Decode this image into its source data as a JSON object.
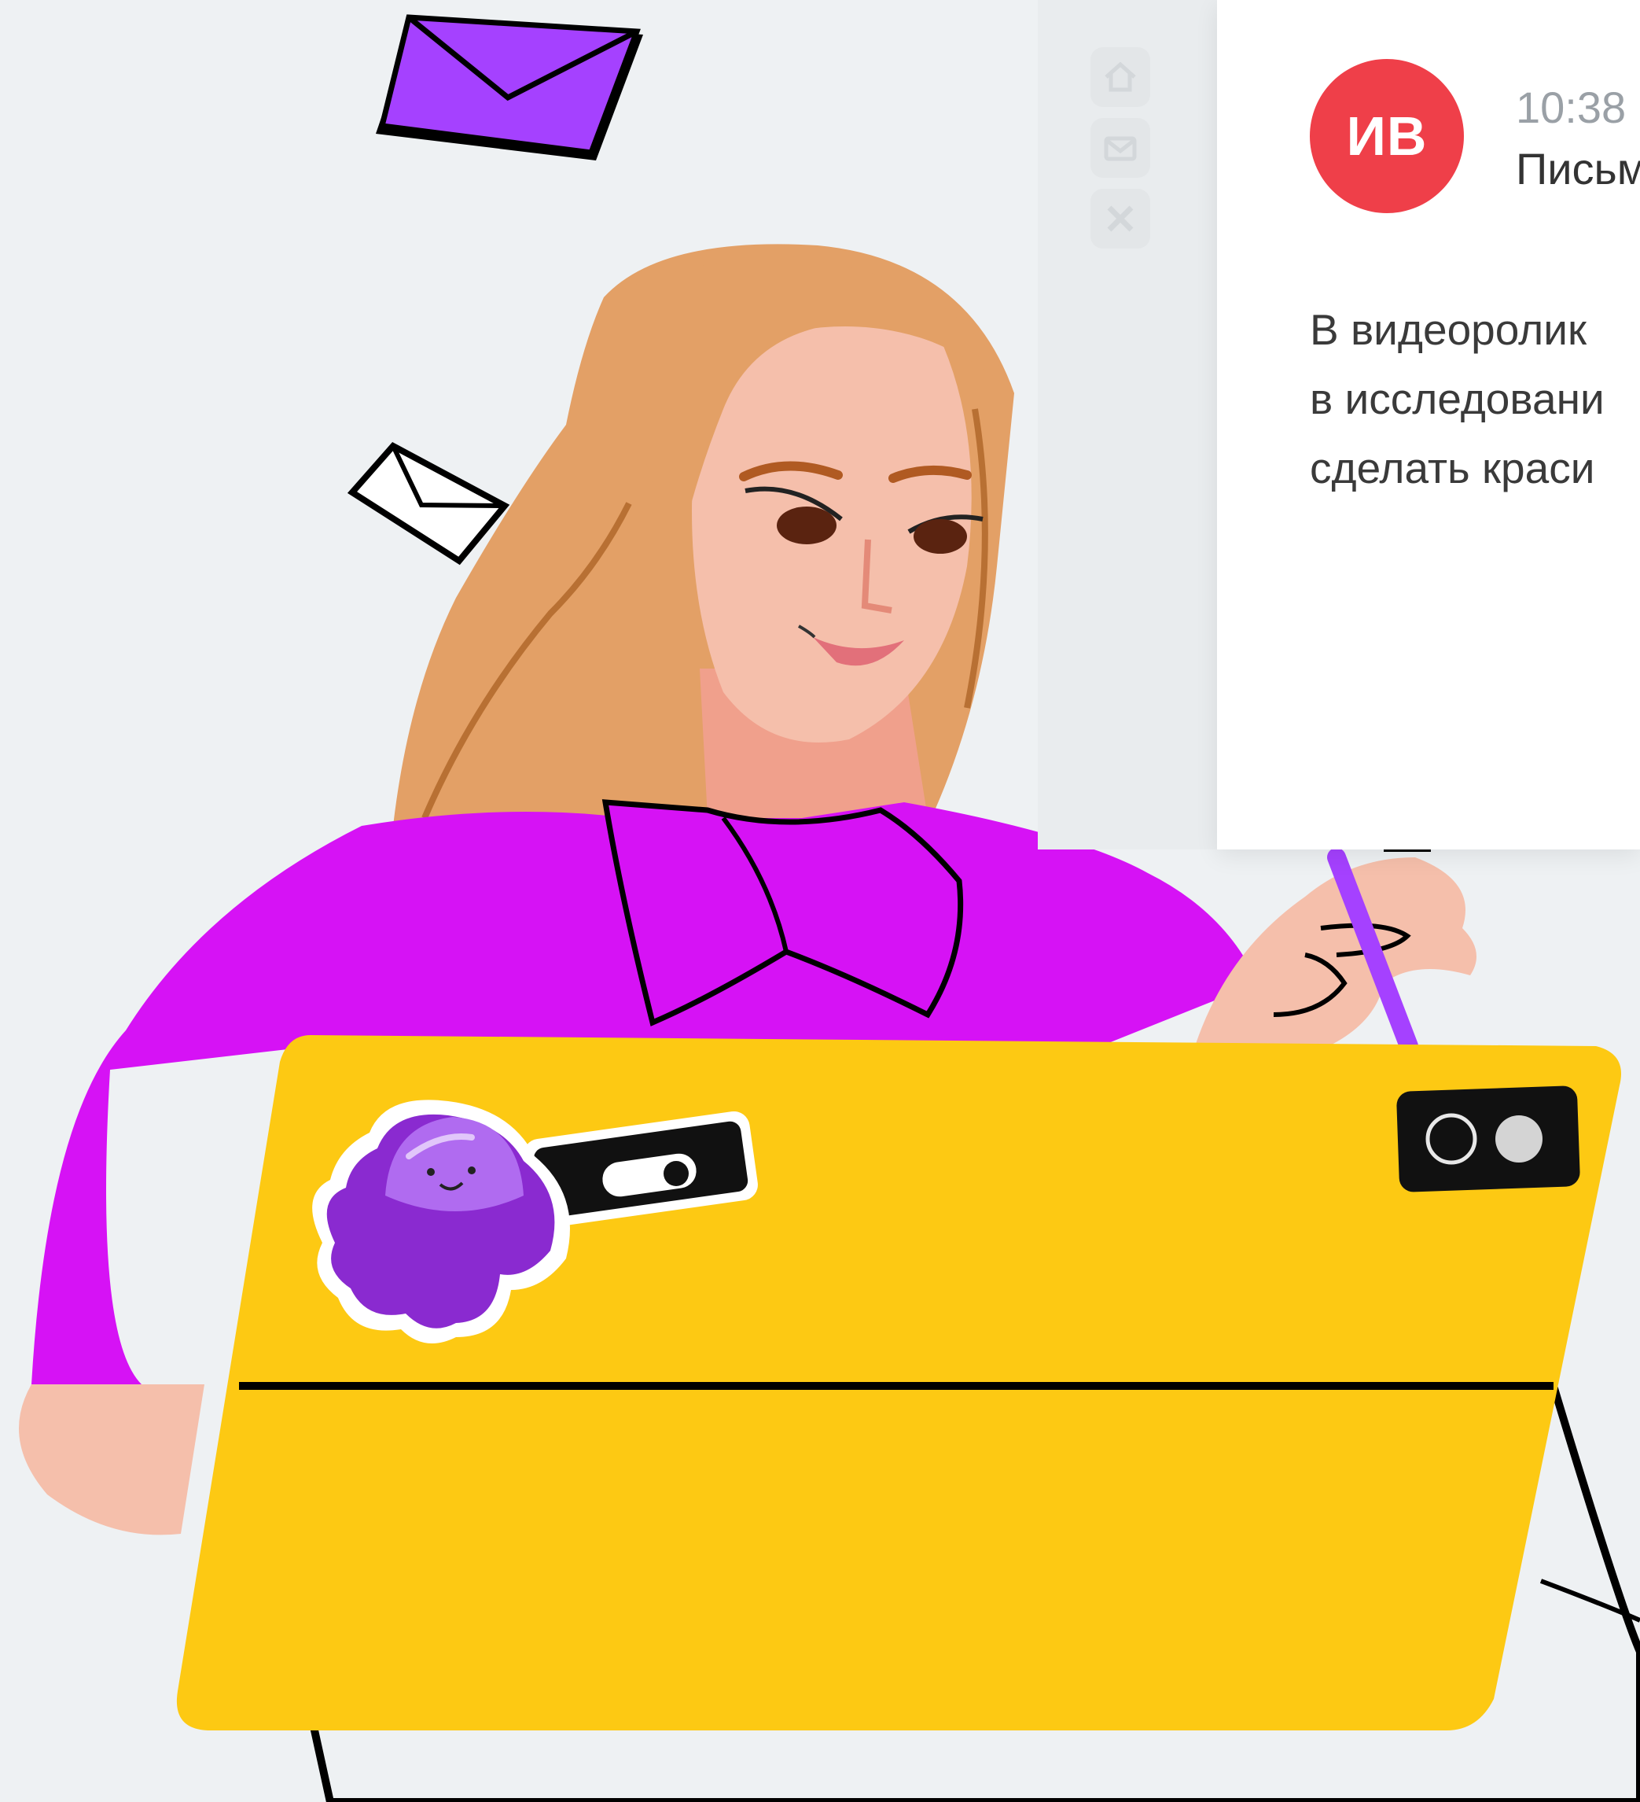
{
  "email": {
    "avatar_initials": "ИВ",
    "time": "10:38",
    "subject_line": "Письм",
    "body_lines": [
      "В видеоролик",
      "в исследовани",
      "сделать краси"
    ]
  },
  "sidebar": {
    "items": [
      {
        "icon": "home-icon"
      },
      {
        "icon": "mail-icon"
      },
      {
        "icon": "close-icon"
      }
    ]
  },
  "colors": {
    "avatar": "#ef3f49",
    "shirt": "#d612f5",
    "tablet": "#fdc913",
    "envelope": "#a541ff",
    "hair": "#e3a066",
    "skin": "#f5bfab",
    "octopus": "#8a2ad0"
  }
}
